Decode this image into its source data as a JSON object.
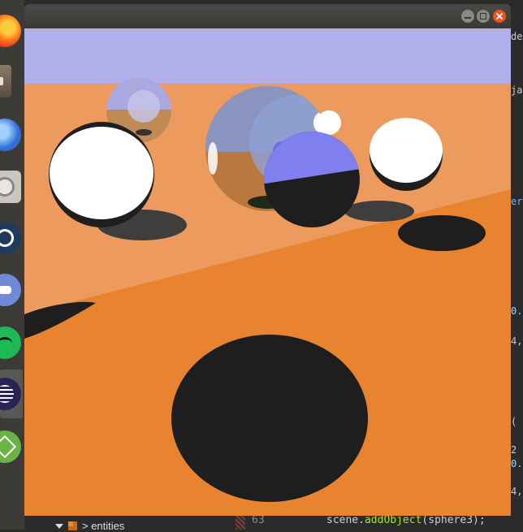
{
  "window": {
    "buttons": [
      "minimize-button",
      "maximize-button",
      "close-button"
    ]
  },
  "dock": {
    "items": [
      {
        "name": "firefox-icon"
      },
      {
        "name": "files-icon"
      },
      {
        "name": "thunderbird-icon"
      },
      {
        "name": "disk-utility-icon"
      },
      {
        "name": "steam-icon"
      },
      {
        "name": "discord-icon"
      },
      {
        "name": "spotify-icon"
      },
      {
        "name": "eclipse-icon"
      },
      {
        "name": "android-studio-icon"
      }
    ]
  },
  "ide": {
    "tree_item": "> entities",
    "line_number": "63",
    "code": {
      "object": "scene.",
      "method": "addObject",
      "args": "(sphere3);"
    },
    "right_fragments": [
      "del",
      "ja",
      "er",
      "0.",
      "4,",
      "(",
      "2",
      "0.",
      "4,"
    ]
  },
  "colors": {
    "sky": "#b0aeeb",
    "floor_far": "#ec9a5e",
    "floor_near": "#e8832f",
    "shadow": "#1e1e1e",
    "sphere_white": "#ffffff",
    "sphere_blue": "#7f7ff0",
    "close_button": "#e95420"
  }
}
